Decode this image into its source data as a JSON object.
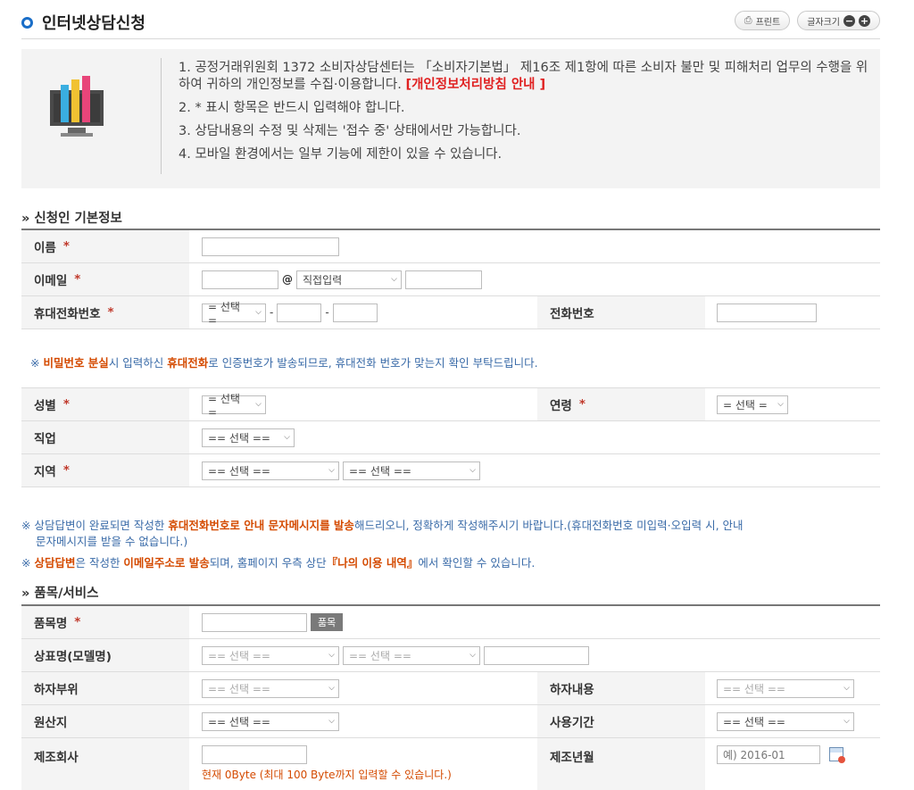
{
  "header": {
    "title": "인터넷상담신청",
    "print_label": "프린트",
    "fontsize_label": "글자크기",
    "fontsize_minus": "−",
    "fontsize_plus": "+"
  },
  "notice": {
    "item1": "1. 공정거래위원회 1372 소비자상담센터는 「소비자기본법」 제16조 제1항에 따른 소비자 불만 및 피해처리 업무의 수행을 위하여 귀하의 개인정보를 수집·이용합니다.",
    "item1_link": "[개인정보처리방침 안내 ]",
    "item2": "2. * 표시 항목은 반드시 입력해야 합니다.",
    "item3": "3. 상담내용의 수정 및 삭제는 '접수 중' 상태에서만 가능합니다.",
    "item4": "4. 모바일 환경에서는 일부 기능에 제한이 있을 수 있습니다."
  },
  "section1": {
    "title": "» 신청인 기본정보",
    "name_label": "이름",
    "email_label": "이메일",
    "email_at": "@",
    "email_domain_select": "직접입력",
    "mobile_label": "휴대전화번호",
    "mobile_select": "= 선택 =",
    "dash": "-",
    "phone_label": "전화번호",
    "mobile_note_prefix": "※ ",
    "mobile_note_hl1": "비밀번호 분실",
    "mobile_note_mid1": "시 입력하신 ",
    "mobile_note_hl2": "휴대전화",
    "mobile_note_rest": "로 인증번호가 발송되므로, 휴대전화 번호가 맞는지 확인 부탁드립니다.",
    "gender_label": "성별",
    "gender_select": "= 선택 =",
    "age_label": "연령",
    "age_select": "= 선택 =",
    "job_label": "직업",
    "job_select": "== 선택 ==",
    "region_label": "지역",
    "region_select1": "== 선택 ==",
    "region_select2": "== 선택 =="
  },
  "notes": {
    "n1_prefix": "※ 상담답변이 완료되면 작성한 ",
    "n1_hl": "휴대전화번호로 안내 문자메시지를 발송",
    "n1_rest": "해드리오니, 정확하게 작성해주시기 바랍니다.(휴대전화번호 미입력·오입력 시, 안내",
    "n1_line2": "문자메시지를 받을 수 없습니다.)",
    "n2_prefix": "※ ",
    "n2_hl1": "상담답변",
    "n2_mid": "은 작성한 ",
    "n2_hl2": "이메일주소로 발송",
    "n2_mid2": "되며, 홈페이지 우측 상단",
    "n2_hl3": "『나의 이용 내역』",
    "n2_rest": "에서 확인할 수 있습니다."
  },
  "section2": {
    "title": "» 품목/서비스",
    "item_label": "품목명",
    "item_button": "품목",
    "brand_label": "상표명(모델명)",
    "brand_select1": "== 선택 ==",
    "brand_select2": "== 선택 ==",
    "defect_part_label": "하자부위",
    "defect_part_select": "== 선택 ==",
    "defect_content_label": "하자내용",
    "defect_content_select": "== 선택 ==",
    "origin_label": "원산지",
    "origin_select": "== 선택 ==",
    "period_label": "사용기간",
    "period_select": "== 선택 ==",
    "maker_label": "제조회사",
    "maker_hint": "현재 0Byte (최대 100 Byte까지 입력할 수 있습니다.)",
    "date_label": "제조년월",
    "date_placeholder": "예) 2016-01"
  },
  "required_mark": "*"
}
